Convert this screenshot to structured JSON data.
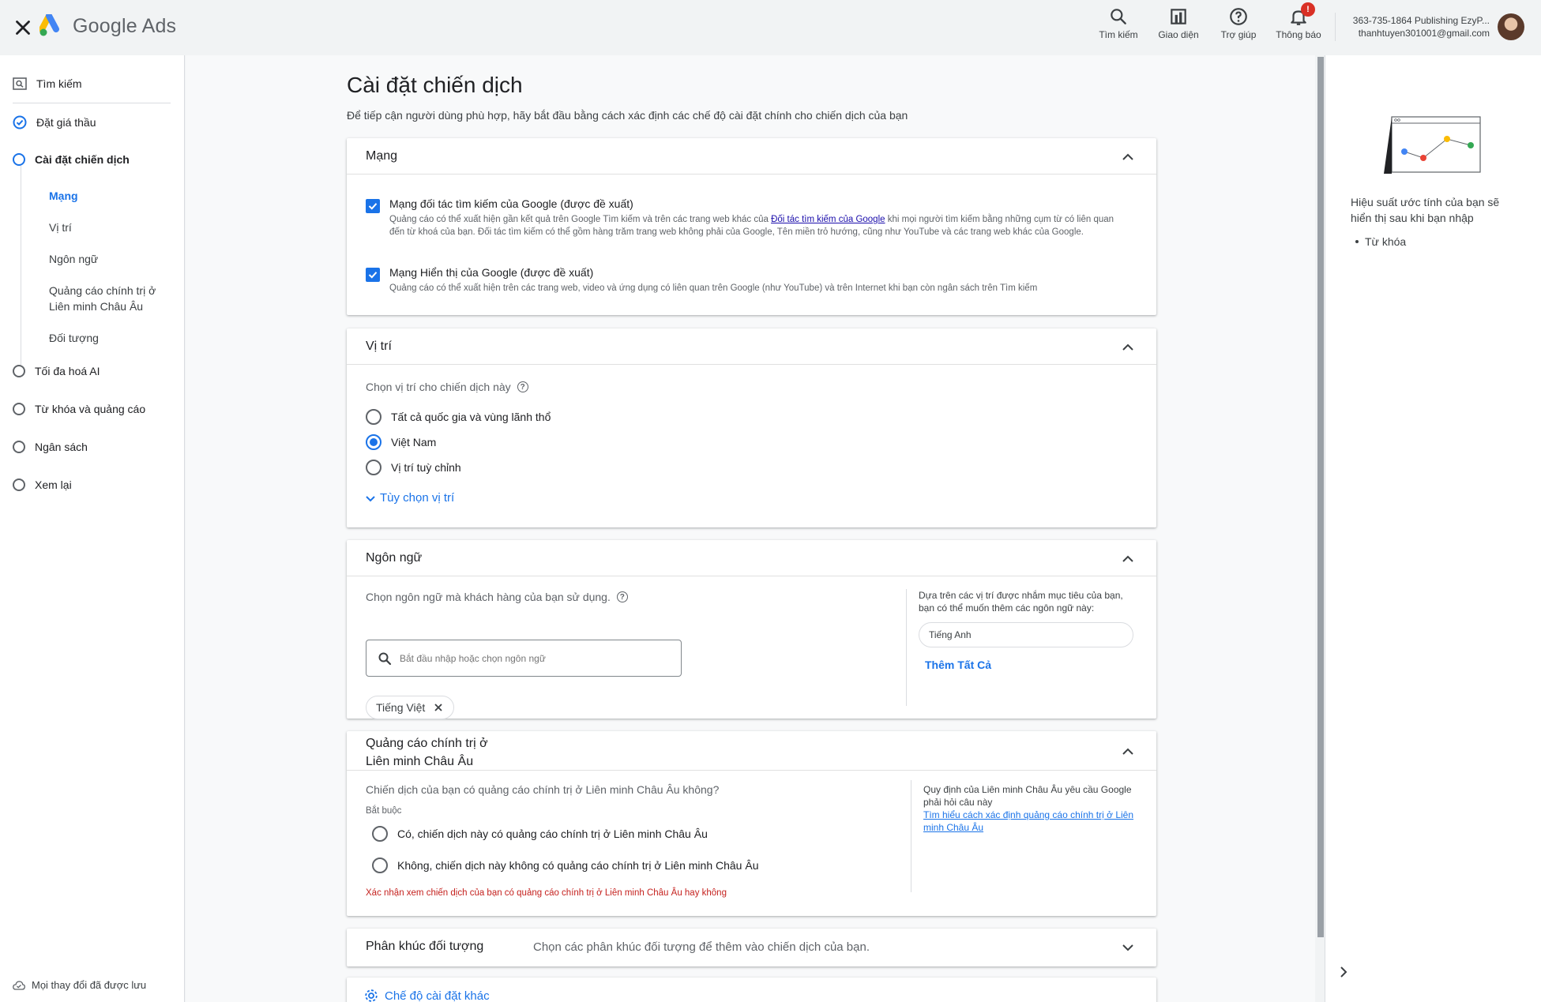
{
  "app": {
    "name": "Google Ads"
  },
  "header": {
    "actions": [
      {
        "label": "Tìm kiếm",
        "icon": "search-icon"
      },
      {
        "label": "Giao diện",
        "icon": "appearance-icon"
      },
      {
        "label": "Trợ giúp",
        "icon": "help-icon"
      },
      {
        "label": "Thông báo",
        "icon": "bell-icon",
        "badge": "!"
      }
    ],
    "account_name": "363-735-1864 Publishing EzyP...",
    "account_email": "thanhtuyen301001@gmail.com"
  },
  "sidebar": {
    "items": [
      {
        "label": "Tìm kiếm",
        "state": "search"
      },
      {
        "label": "Đặt giá thầu",
        "state": "done"
      },
      {
        "label": "Cài đặt chiến dịch",
        "state": "active"
      },
      {
        "label": "Tối đa hoá AI",
        "state": "todo"
      },
      {
        "label": "Từ khóa và quảng cáo",
        "state": "todo"
      },
      {
        "label": "Ngân sách",
        "state": "todo"
      },
      {
        "label": "Xem lại",
        "state": "todo"
      }
    ],
    "subitems": [
      {
        "label": "Mạng",
        "active": true
      },
      {
        "label": "Vị trí"
      },
      {
        "label": "Ngôn ngữ"
      },
      {
        "label": "Quảng cáo chính trị ở Liên minh Châu Âu"
      },
      {
        "label": "Đối tượng"
      }
    ],
    "saved_status": "Mọi thay đổi đã được lưu"
  },
  "page": {
    "title": "Cài đặt chiến dịch",
    "subtitle": "Để tiếp cận người dùng phù hợp, hãy bắt đầu bằng cách xác định các chế độ cài đặt chính cho chiến dịch của bạn"
  },
  "networks": {
    "title": "Mạng",
    "search": {
      "label": "Mạng đối tác tìm kiếm của Google (được đề xuất)",
      "desc_before": "Quảng cáo có thể xuất hiện gần kết quả trên Google Tìm kiếm và trên các trang web khác của ",
      "desc_link": "Đối tác tìm kiếm của Google",
      "desc_after": " khi mọi người tìm kiếm bằng những cụm từ có liên quan đến từ khoá của bạn. Đối tác tìm kiếm có thể gồm hàng trăm trang web không phải của Google, Tên miền trỏ hướng, cũng như YouTube và các trang web khác của Google.",
      "checked": true
    },
    "display": {
      "label": "Mạng Hiển thị của Google (được đề xuất)",
      "desc": "Quảng cáo có thể xuất hiện trên các trang web, video và ứng dụng có liên quan trên Google (như YouTube) và trên Internet khi bạn còn ngân sách trên Tìm kiếm",
      "checked": true
    }
  },
  "location": {
    "title": "Vị trí",
    "prompt": "Chọn vị trí cho chiến dịch này",
    "options": [
      {
        "label": "Tất cả quốc gia và vùng lãnh thổ",
        "selected": false
      },
      {
        "label": "Việt Nam",
        "selected": true
      },
      {
        "label": "Vị trí tuỳ chỉnh",
        "selected": false
      }
    ],
    "more_options": "Tùy chọn vị trí"
  },
  "language": {
    "title": "Ngôn ngữ",
    "prompt": "Chọn ngôn ngữ mà khách hàng của bạn sử dụng.",
    "search_placeholder": "Bắt đầu nhập hoặc chọn ngôn ngữ",
    "selected_chip": "Tiếng Việt",
    "suggestion_text": "Dựa trên các vị trí được nhắm mục tiêu của bạn, bạn có thể muốn thêm các ngôn ngữ này:",
    "suggested": "Tiếng Anh",
    "add_all": "Thêm Tất Cả"
  },
  "eu_political": {
    "title_line1": "Quảng cáo chính trị ở",
    "title_line2": "Liên minh Châu Âu",
    "question": "Chiến dịch của bạn có quảng cáo chính trị ở Liên minh Châu Âu không?",
    "required": "Bắt buộc",
    "options": [
      {
        "label": "Có, chiến dịch này có quảng cáo chính trị ở Liên minh Châu Âu",
        "selected": false
      },
      {
        "label": "Không, chiến dịch này không có quảng cáo chính trị ở Liên minh Châu Âu",
        "selected": false
      }
    ],
    "error": "Xác nhận xem chiến dịch của bạn có quảng cáo chính trị ở Liên minh Châu Âu hay không",
    "side_note": "Quy định của Liên minh Châu Âu yêu cầu Google phải hỏi câu này",
    "side_link": "Tìm hiểu cách xác định quảng cáo chính trị ở Liên minh Châu Âu"
  },
  "audience": {
    "title": "Phân khúc đối tượng",
    "desc": "Chọn các phân khúc đối tượng để thêm vào chiến dịch của bạn."
  },
  "more_settings": {
    "label": "Chế độ cài đặt khác"
  },
  "right_panel": {
    "text": "Hiệu suất ước tính của bạn sẽ hiển thị sau khi bạn nhập",
    "bullet": "Từ khóa"
  },
  "colors": {
    "accent": "#1a73e8",
    "error": "#c5221f",
    "badge": "#d93025",
    "logo_blue": "#4285f4",
    "logo_yellow": "#fbbc04",
    "logo_green": "#34a853"
  }
}
